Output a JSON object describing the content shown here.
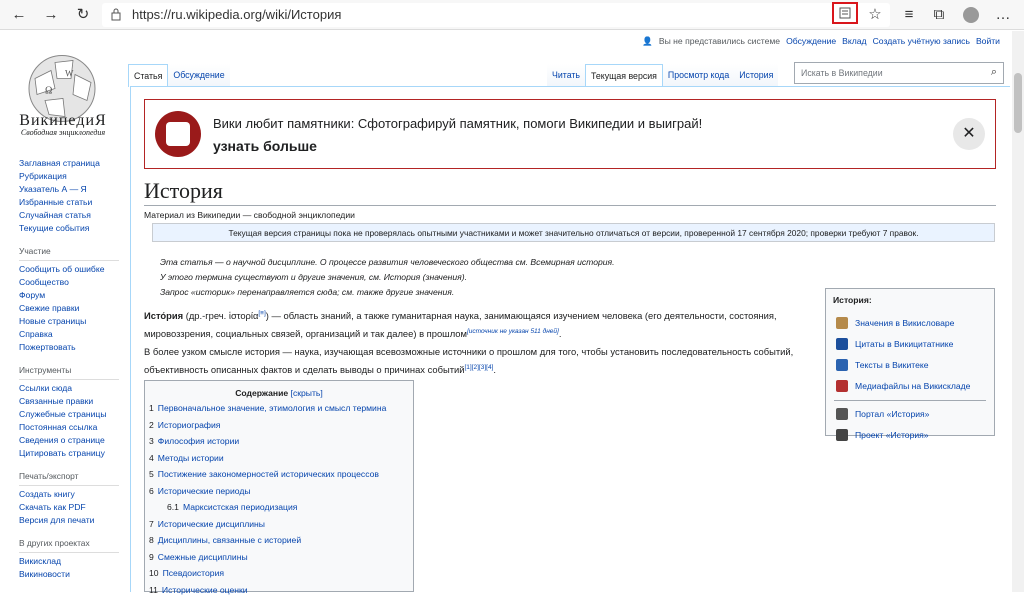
{
  "browser": {
    "url": "https://ru.wikipedia.org/wiki/История"
  },
  "logo": {
    "name": "ВикипедиЯ",
    "tagline": "Свободная энциклопедия"
  },
  "personal": [
    "Вы не представились системе",
    "Обсуждение",
    "Вклад",
    "Создать учётную запись",
    "Войти"
  ],
  "tabs_left": [
    "Статья",
    "Обсуждение"
  ],
  "tabs_right": [
    "Читать",
    "Текущая версия",
    "Просмотр кода",
    "История"
  ],
  "search": {
    "placeholder": "Искать в Википедии"
  },
  "nav": {
    "main": [
      "Заглавная страница",
      "Рубрикация",
      "Указатель А — Я",
      "Избранные статьи",
      "Случайная статья",
      "Текущие события"
    ],
    "participation_head": "Участие",
    "participation": [
      "Сообщить об ошибке",
      "Сообщество",
      "Форум",
      "Свежие правки",
      "Новые страницы",
      "Справка",
      "Пожертвовать"
    ],
    "tools_head": "Инструменты",
    "tools": [
      "Ссылки сюда",
      "Связанные правки",
      "Служебные страницы",
      "Постоянная ссылка",
      "Сведения о странице",
      "Цитировать страницу"
    ],
    "print_head": "Печать/экспорт",
    "print": [
      "Создать книгу",
      "Скачать как PDF",
      "Версия для печати"
    ],
    "other_head": "В других проектах",
    "other": [
      "Викисклад",
      "Викиновости"
    ]
  },
  "banner": {
    "text": "Вики любит памятники: Сфотографируй памятник, помоги Википедии и выиграй!",
    "link": "узнать больше"
  },
  "article": {
    "title": "История",
    "tagline": "Материал из Википедии — свободной энциклопедии",
    "flagged": "Текущая версия страницы пока не проверялась опытными участниками и может значительно отличаться от версии, проверенной 17 сентября 2020; проверки требуют 7 правок.",
    "hat1": "Эта статья — о научной дисциплине. О процессе развития человеческого общества см. Всемирная история.",
    "hat2": "У этого термина существуют и другие значения, см. История (значения).",
    "hat3": "Запрос «историк» перенаправляется сюда; см. также другие значения.",
    "p1a": "Исто́рия",
    "p1b": " (др.-греч. ἱστορία",
    "p1c": ") — область знаний, а также гуманитарная наука, занимающаяся изучением человека (его деятельности, состояния, мировоззрения, социальных связей, организаций и так далее) в прошлом",
    "p1d": "[источник не указан 511 дней]",
    "p2": "В более узком смысле история — наука, изучающая всевозможные источники о прошлом для того, чтобы установить последовательность событий, объективность описанных фактов и сделать выводы о причинах событий",
    "p2refs": "[1][2][3][4]"
  },
  "infobox": {
    "title": "История:",
    "items": [
      "Значения в Викисловаре",
      "Цитаты в Викицитатнике",
      "Тексты в Викитеке",
      "Медиафайлы на Викискладе",
      "Портал «История»",
      "Проект «История»"
    ]
  },
  "toc": {
    "title": "Содержание",
    "hide": "[скрыть]",
    "items": [
      {
        "n": "1",
        "t": "Первоначальное значение, этимология и смысл термина"
      },
      {
        "n": "2",
        "t": "Историография"
      },
      {
        "n": "3",
        "t": "Философия истории"
      },
      {
        "n": "4",
        "t": "Методы истории"
      },
      {
        "n": "5",
        "t": "Постижение закономерностей исторических процессов"
      },
      {
        "n": "6",
        "t": "Исторические периоды"
      },
      {
        "n": "6.1",
        "t": "Марксистская периодизация"
      },
      {
        "n": "7",
        "t": "Исторические дисциплины"
      },
      {
        "n": "8",
        "t": "Дисциплины, связанные с историей"
      },
      {
        "n": "9",
        "t": "Смежные дисциплины"
      },
      {
        "n": "10",
        "t": "Псевдоистория"
      },
      {
        "n": "11",
        "t": "Исторические оценки"
      }
    ]
  }
}
